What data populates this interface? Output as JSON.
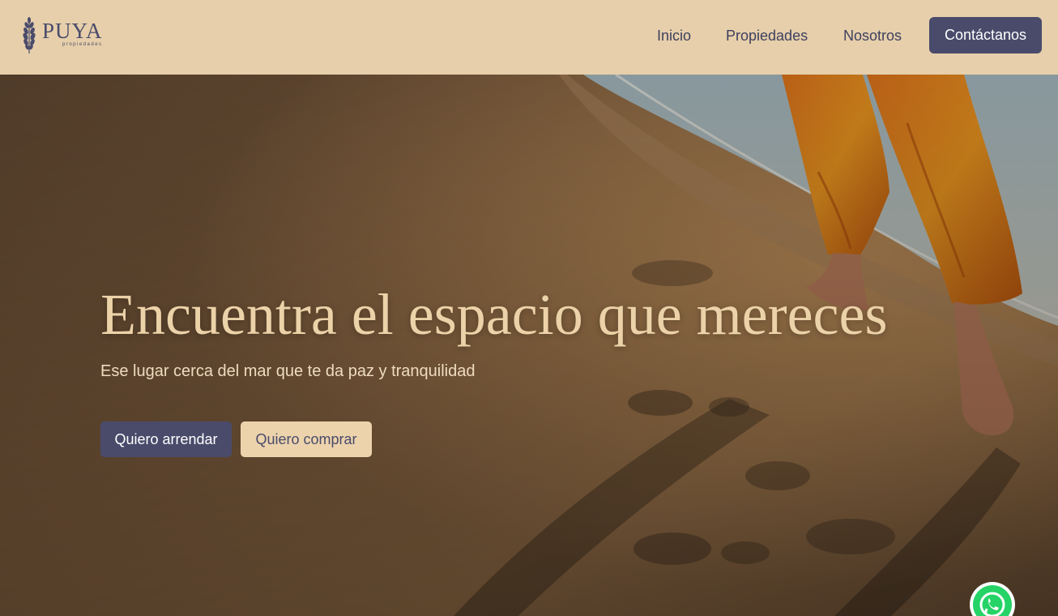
{
  "brand": {
    "name": "PUYA",
    "subtitle": "propiedades"
  },
  "nav": {
    "items": [
      {
        "label": "Inicio"
      },
      {
        "label": "Propiedades"
      },
      {
        "label": "Nosotros"
      }
    ],
    "cta_label": "Contáctanos"
  },
  "hero": {
    "title": "Encuentra el espacio que mereces",
    "subtitle": "Ese lugar cerca del mar que te da paz y tranquilidad",
    "buttons": {
      "rent_label": "Quiero arrendar",
      "buy_label": "Quiero comprar"
    },
    "background_image": "beach-footprints-photo"
  },
  "floating": {
    "whatsapp_icon": "whatsapp-icon"
  },
  "colors": {
    "header_bg": "#e6cfaa",
    "primary": "#4a4b6b",
    "accent": "#ecd3ac",
    "headline": "#ecd2a8",
    "whatsapp": "#25d366"
  }
}
